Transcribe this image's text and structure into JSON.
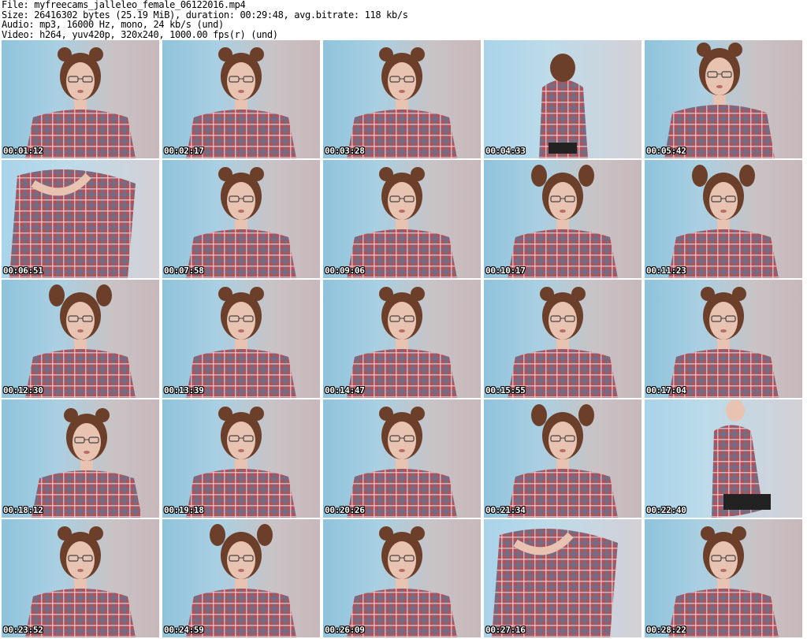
{
  "header": {
    "file_line": "File: myfreecams_jalleleo_female_06122016.mp4",
    "size_line": "Size: 26416302 bytes (25.19 MiB), duration: 00:29:48, avg.bitrate: 118 kb/s",
    "audio_line": "Audio: mp3, 16000 Hz, mono, 24 kb/s (und)",
    "video_line": "Video: h264, yuv420p, 320x240, 1000.00 fps(r) (und)"
  },
  "thumbnails": [
    {
      "timestamp": "00:01:12",
      "pose": "center"
    },
    {
      "timestamp": "00:02:17",
      "pose": "center"
    },
    {
      "timestamp": "00:03:28",
      "pose": "center"
    },
    {
      "timestamp": "00:04:33",
      "pose": "back"
    },
    {
      "timestamp": "00:05:42",
      "pose": "lean"
    },
    {
      "timestamp": "00:06:51",
      "pose": "closeup-body"
    },
    {
      "timestamp": "00:07:58",
      "pose": "center"
    },
    {
      "timestamp": "00:09:06",
      "pose": "center"
    },
    {
      "timestamp": "00:10:17",
      "pose": "pigtails"
    },
    {
      "timestamp": "00:11:23",
      "pose": "pigtails"
    },
    {
      "timestamp": "00:12:30",
      "pose": "pigtails"
    },
    {
      "timestamp": "00:13:39",
      "pose": "center"
    },
    {
      "timestamp": "00:14:47",
      "pose": "center"
    },
    {
      "timestamp": "00:15:55",
      "pose": "center"
    },
    {
      "timestamp": "00:17:04",
      "pose": "center"
    },
    {
      "timestamp": "00:18:12",
      "pose": "tilt"
    },
    {
      "timestamp": "00:19:18",
      "pose": "center"
    },
    {
      "timestamp": "00:20:26",
      "pose": "center"
    },
    {
      "timestamp": "00:21:34",
      "pose": "pigtails"
    },
    {
      "timestamp": "00:22:40",
      "pose": "standing"
    },
    {
      "timestamp": "00:23:52",
      "pose": "center"
    },
    {
      "timestamp": "00:24:59",
      "pose": "pigtails"
    },
    {
      "timestamp": "00:26:09",
      "pose": "center"
    },
    {
      "timestamp": "00:27:16",
      "pose": "closeup-body"
    },
    {
      "timestamp": "00:28:22",
      "pose": "center"
    }
  ]
}
